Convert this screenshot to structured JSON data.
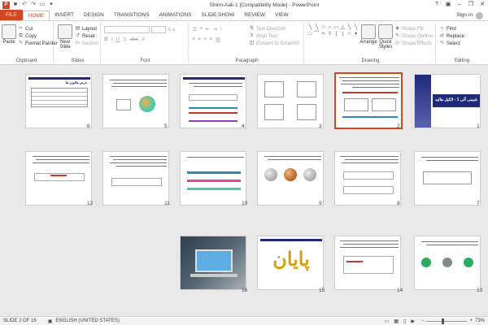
{
  "window": {
    "title": "Shimi-Aali-1 [Compatibility Mode] - PowerPoint",
    "controls": [
      "?",
      "▣",
      "–",
      "❐",
      "✕"
    ]
  },
  "tabs": [
    "FILE",
    "HOME",
    "INSERT",
    "DESIGN",
    "TRANSITIONS",
    "ANIMATIONS",
    "SLIDE SHOW",
    "REVIEW",
    "VIEW"
  ],
  "signin": "Sign in",
  "ribbon": {
    "clipboard": {
      "paste": "Paste",
      "cut": "Cut",
      "copy": "Copy",
      "format_painter": "Format Painter",
      "label": "Clipboard"
    },
    "slides": {
      "new_slide": "New Slide",
      "layout": "Layout",
      "reset": "Reset",
      "section": "Section",
      "label": "Slides"
    },
    "font": {
      "label": "Font"
    },
    "paragraph": {
      "text_direction": "Text Direction",
      "align_text": "Align Text",
      "convert_smartart": "Convert to SmartArt",
      "label": "Paragraph"
    },
    "drawing": {
      "arrange": "Arrange",
      "quick_styles": "Quick Styles",
      "shape_fill": "Shape Fill",
      "shape_outline": "Shape Outline",
      "shape_effects": "Shape Effects",
      "label": "Drawing"
    },
    "editing": {
      "find": "Find",
      "replace": "Replace",
      "select": "Select",
      "label": "Editing"
    }
  },
  "slides": [
    {
      "num": "1",
      "title": "شیمی آلی 1 - الکیل هالید"
    },
    {
      "num": "2"
    },
    {
      "num": "3"
    },
    {
      "num": "4"
    },
    {
      "num": "5"
    },
    {
      "num": "6",
      "title": "عرض هالوژن ها"
    },
    {
      "num": "7"
    },
    {
      "num": "8"
    },
    {
      "num": "9"
    },
    {
      "num": "10"
    },
    {
      "num": "11"
    },
    {
      "num": "12"
    },
    {
      "num": "13"
    },
    {
      "num": "14"
    },
    {
      "num": "15",
      "title": "پایان"
    },
    {
      "num": "16"
    }
  ],
  "status": {
    "slide": "SLIDE 2 OF 16",
    "language": "ENGLISH (UNITED STATES)",
    "zoom": "73%",
    "zoom_fraction": 0.73
  },
  "colors": {
    "accent": "#d24726",
    "slide_bar": "#1f2a7a",
    "selected_border": "#d24726"
  }
}
